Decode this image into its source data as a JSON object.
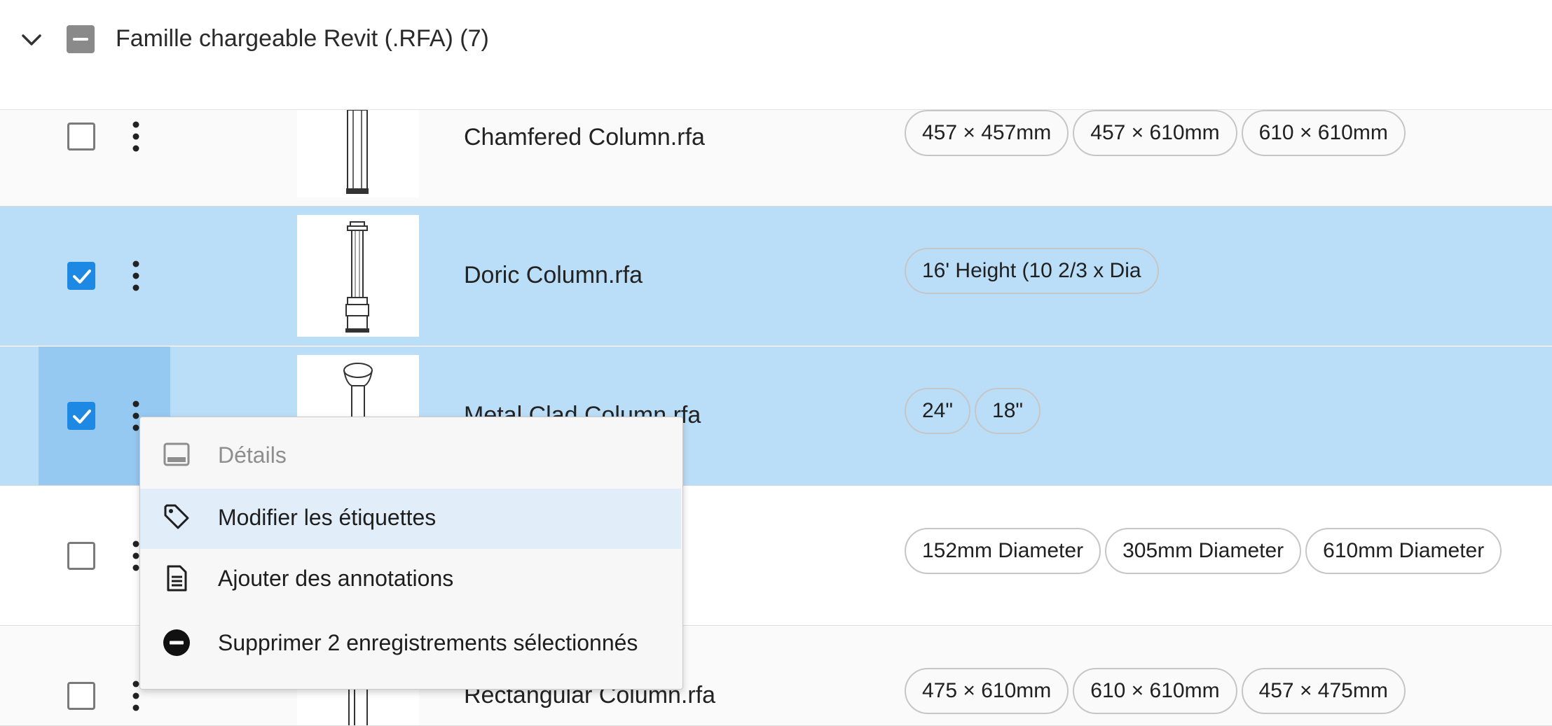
{
  "group": {
    "title": "Famille chargeable Revit (.RFA) (7)",
    "checkbox_state": "indeterminate"
  },
  "rows": [
    {
      "name": "Chamfered Column.rfa",
      "checked": false,
      "tags": [
        "457 × 457mm",
        "457 × 610mm",
        "610 × 610mm"
      ]
    },
    {
      "name": "Doric Column.rfa",
      "checked": true,
      "tags": [
        "16' Height (10 2/3 x Dia"
      ]
    },
    {
      "name": "Metal Clad Column.rfa",
      "checked": true,
      "tags": [
        "24\"",
        "18\""
      ]
    },
    {
      "name": "",
      "checked": false,
      "tags": [
        "152mm Diameter",
        "305mm Diameter",
        "610mm Diameter"
      ]
    },
    {
      "name": "Rectangular Column.rfa",
      "checked": false,
      "tags": [
        "475 × 610mm",
        "610 × 610mm",
        "457 × 475mm"
      ]
    }
  ],
  "context_menu": {
    "items": [
      {
        "label": "Détails",
        "icon": "details-panel-icon",
        "disabled": true
      },
      {
        "label": "Modifier les étiquettes",
        "icon": "tag-icon",
        "disabled": false,
        "highlighted": true
      },
      {
        "label": "Ajouter des annotations",
        "icon": "document-icon",
        "disabled": false
      },
      {
        "label": "Supprimer 2 enregistrements sélectionnés",
        "icon": "remove-circle-icon",
        "disabled": false
      }
    ]
  },
  "colors": {
    "selected_row": "#bbdef8",
    "hover_cell": "#95c9f2",
    "checkbox_checked": "#1e88e5",
    "menu_highlight": "#e1edf8"
  }
}
